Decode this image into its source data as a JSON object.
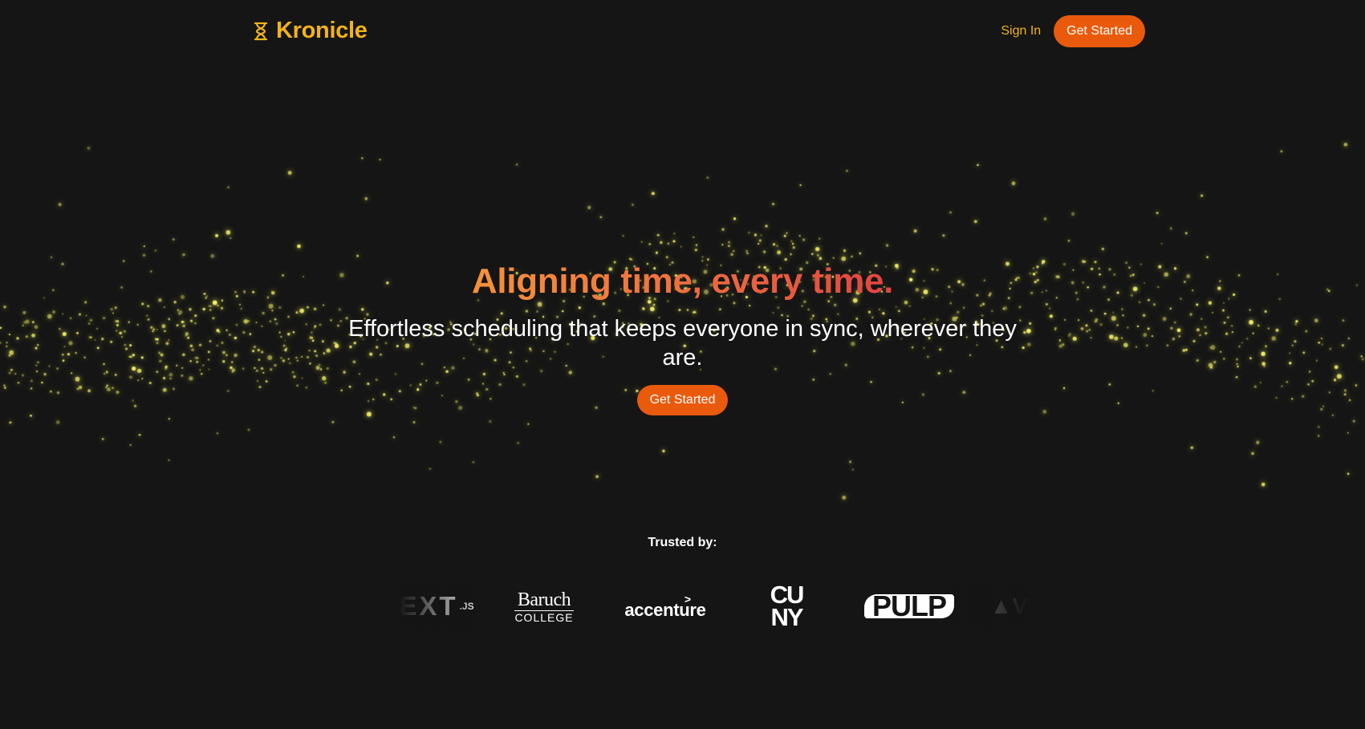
{
  "header": {
    "brand_name": "Kronicle",
    "sign_in_label": "Sign In",
    "get_started_label": "Get Started"
  },
  "hero": {
    "headline": "Aligning time, every time.",
    "subheadline": "Effortless scheduling that keeps everyone in sync, wherever they are.",
    "cta_label": "Get Started"
  },
  "trusted": {
    "label": "Trusted by:",
    "logos": [
      {
        "name": "Next.js",
        "text": "EXT",
        "suffix": ".JS"
      },
      {
        "name": "Baruch College",
        "line1": "Baruch",
        "line2": "COLLEGE"
      },
      {
        "name": "accenture",
        "mark": ">",
        "text": "accenture"
      },
      {
        "name": "CUNY",
        "line1": "CU",
        "line2": "NY"
      },
      {
        "name": "PULP",
        "text": "PULP"
      },
      {
        "name": "Vercel",
        "text": "▲V"
      }
    ]
  },
  "colors": {
    "background": "#151515",
    "brand_yellow": "#f2b21a",
    "accent_orange": "#ea5a0c",
    "headline_gradient_start": "#f4923b",
    "headline_gradient_end": "#e0443f",
    "particle": "#f4f36a"
  },
  "icons": {
    "brand": "hourglass-icon"
  }
}
